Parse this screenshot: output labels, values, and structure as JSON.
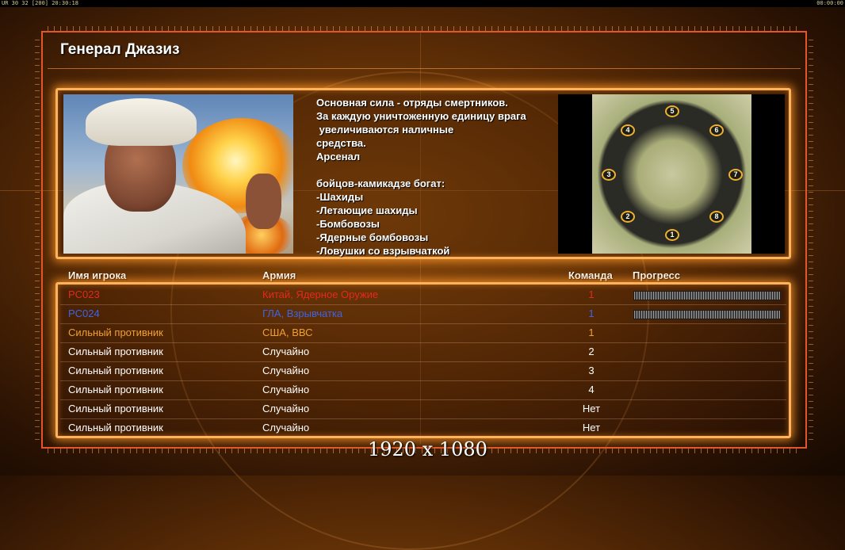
{
  "topbar": {
    "left_text": "UR 30 32 [200] 20:30:18",
    "right_text": "00:00:00"
  },
  "general": {
    "title": "Генерал Джазиз",
    "description_lines": [
      "Основная сила - отряды смертников.",
      "За каждую уничтоженную единицу врага",
      " увеличиваются наличные",
      "средства.",
      "Арсенал",
      "",
      "бойцов-камикадзе богат:",
      "-Шахиды",
      "-Летающие шахиды",
      "-Бомбовозы",
      "-Ядерные бомбовозы",
      "-Ловушки со взрывчаткой"
    ]
  },
  "map": {
    "start_positions": [
      "1",
      "2",
      "3",
      "4",
      "5",
      "6",
      "7",
      "8"
    ]
  },
  "table": {
    "headers": {
      "player": "Имя игрока",
      "army": "Армия",
      "team": "Команда",
      "progress": "Прогресс"
    },
    "rows": [
      {
        "name": "PC023",
        "army": "Китай, Ядерное Оружие",
        "team": "1",
        "color": "#e8281c",
        "has_progress": true
      },
      {
        "name": "PC024",
        "army": "ГЛА, Взрывчатка",
        "team": "1",
        "color": "#3e64e6",
        "has_progress": true
      },
      {
        "name": "Сильный противник",
        "army": "США, ВВС",
        "team": "1",
        "color": "#f0a030",
        "has_progress": false
      },
      {
        "name": "Сильный противник",
        "army": "Случайно",
        "team": "2",
        "color": "#ffffff",
        "has_progress": false
      },
      {
        "name": "Сильный противник",
        "army": "Случайно",
        "team": "3",
        "color": "#ffffff",
        "has_progress": false
      },
      {
        "name": "Сильный противник",
        "army": "Случайно",
        "team": "4",
        "color": "#ffffff",
        "has_progress": false
      },
      {
        "name": "Сильный противник",
        "army": "Случайно",
        "team": "Нет",
        "color": "#ffffff",
        "has_progress": false
      },
      {
        "name": "Сильный противник",
        "army": "Случайно",
        "team": "Нет",
        "color": "#ffffff",
        "has_progress": false
      }
    ]
  },
  "resolution_label": "1920 x 1080"
}
